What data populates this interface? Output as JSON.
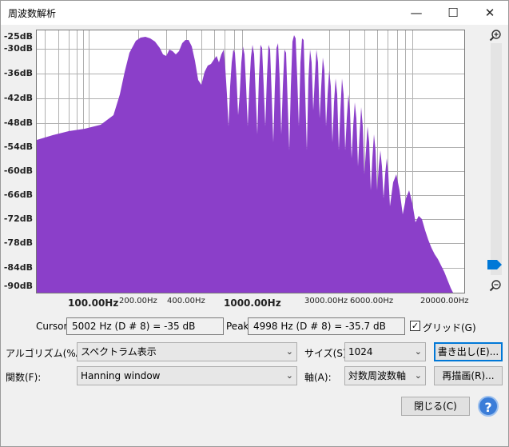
{
  "window": {
    "title": "周波数解析",
    "controls": [
      "—",
      "☐",
      "✕"
    ]
  },
  "colors": {
    "spectrum": "#8b3fc9",
    "grid": "#9a9a9a",
    "accent": "#0078d7"
  },
  "plot": {
    "y_labels": [
      "-25dB",
      "-30dB",
      "-36dB",
      "-42dB",
      "-48dB",
      "-54dB",
      "-60dB",
      "-66dB",
      "-72dB",
      "-78dB",
      "-84dB",
      "-90dB"
    ],
    "x_labels": [
      "100.00Hz",
      "200.00Hz",
      "400.00Hz",
      "1000.00Hz",
      "3000.00Hz",
      "6000.00Hz",
      "20000.00Hz"
    ],
    "zoom_in_icon": "zoom-in-icon",
    "zoom_out_icon": "zoom-out-icon"
  },
  "readouts": {
    "cursor_label": "Cursor:",
    "cursor_value": "5002 Hz (D # 8) = -35 dB",
    "peak_label": "Peak:",
    "peak_value": "4998 Hz (D # 8) = -35.7 dB",
    "grid_label": "グリッド(G)",
    "grid_checked": true,
    "check_mark": "✓"
  },
  "controls": {
    "algorithm_label": "アルゴリズム(%A):",
    "algorithm_value": "スペクトラム表示",
    "size_label": "サイズ(S):",
    "size_value": "1024",
    "function_label": "関数(F):",
    "function_value": "Hanning window",
    "axis_label": "軸(A):",
    "axis_value": "対数周波数軸",
    "export_button": "書き出し(E)...",
    "replot_button": "再描画(R)...",
    "close_button": "閉じる(C)",
    "help_button": "?",
    "dropdown_arrow": "⌄"
  }
}
